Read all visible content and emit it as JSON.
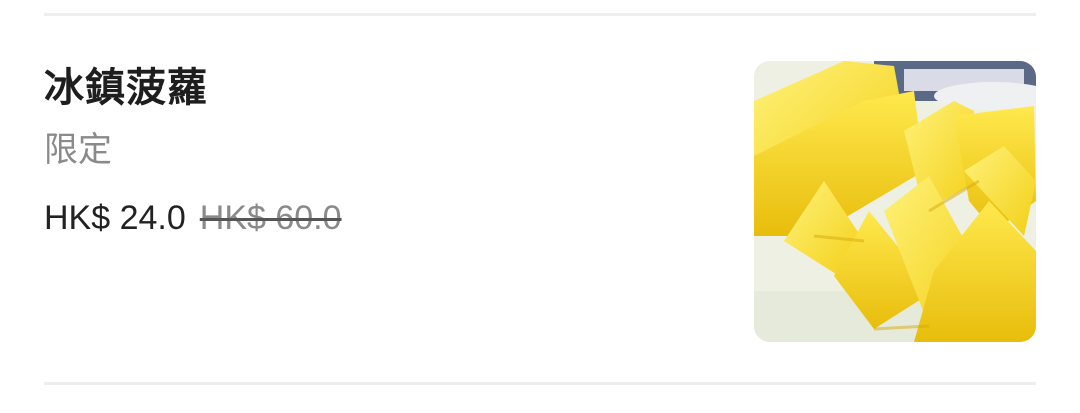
{
  "item": {
    "name": "冰鎮菠蘿",
    "tag": "限定",
    "price": "HK$ 24.0",
    "original_price": "HK$ 60.0",
    "image_icon": "pineapple-photo"
  }
}
